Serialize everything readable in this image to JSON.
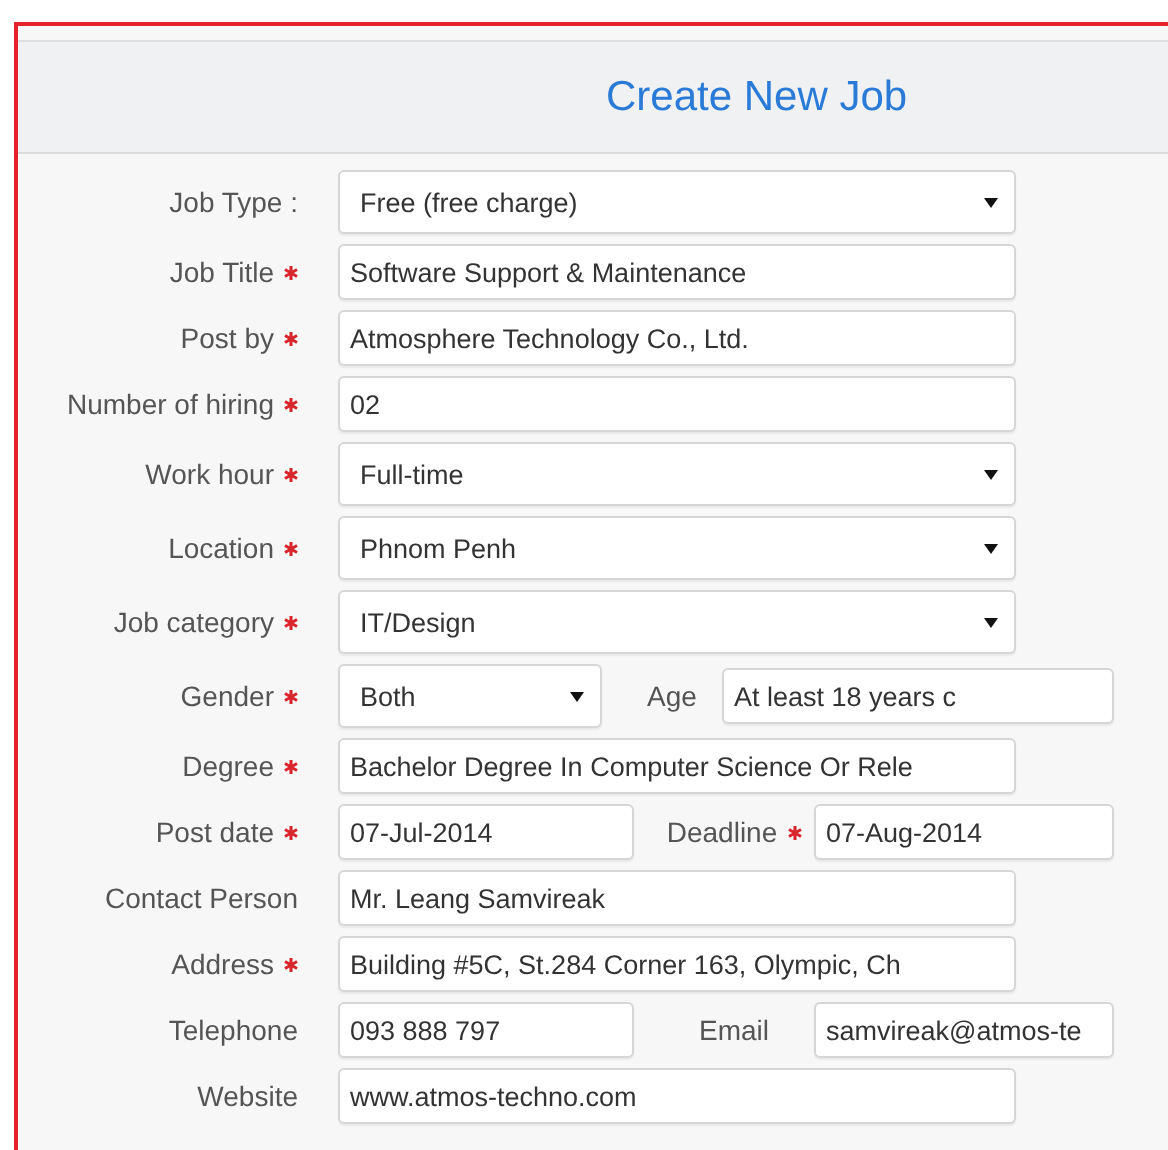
{
  "title": "Create New Job",
  "rows": [
    {
      "label": "Job Type :",
      "required": false,
      "kind": "select",
      "value": "Free (free charge)"
    },
    {
      "label": "Job Title",
      "required": true,
      "kind": "input",
      "value": "Software Support & Maintenance"
    },
    {
      "label": "Post by",
      "required": true,
      "kind": "input",
      "value": "Atmosphere Technology Co., Ltd."
    },
    {
      "label": "Number of hiring",
      "required": true,
      "kind": "input",
      "value": "02"
    },
    {
      "label": "Work hour",
      "required": true,
      "kind": "select",
      "value": "Full-time"
    },
    {
      "label": "Location",
      "required": true,
      "kind": "select",
      "value": "Phnom Penh"
    },
    {
      "label": "Job category",
      "required": true,
      "kind": "select",
      "value": "IT/Design"
    },
    {
      "label": "Gender",
      "required": true,
      "kind": "select",
      "value": "Both",
      "extra": {
        "label": "Age",
        "required": false,
        "kind": "input",
        "value": "At least 18 years c"
      }
    },
    {
      "label": "Degree",
      "required": true,
      "kind": "input",
      "value": "Bachelor Degree In Computer Science Or Rele"
    },
    {
      "label": "Post date",
      "required": true,
      "kind": "input",
      "value": "07-Jul-2014",
      "extra": {
        "label": "Deadline",
        "required": true,
        "kind": "input",
        "value": "07-Aug-2014"
      }
    },
    {
      "label": "Contact Person",
      "required": false,
      "kind": "input",
      "value": "Mr. Leang Samvireak"
    },
    {
      "label": "Address",
      "required": true,
      "kind": "input",
      "value": "Building #5C, St.284 Corner 163, Olympic, Ch"
    },
    {
      "label": "Telephone",
      "required": false,
      "kind": "input",
      "value": "093 888 797",
      "extra": {
        "label": "Email",
        "required": false,
        "kind": "input",
        "value": "samvireak@atmos-te"
      }
    },
    {
      "label": "Website",
      "required": false,
      "kind": "input",
      "value": "www.atmos-techno.com"
    }
  ]
}
